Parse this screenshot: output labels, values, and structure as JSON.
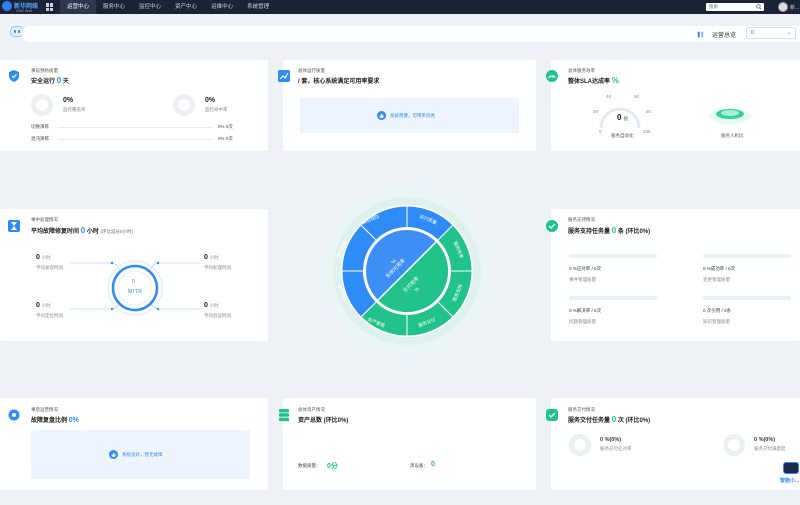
{
  "topbar": {
    "logo_text": "新华网络",
    "logo_sub": "XNC.Net",
    "nav": [
      "运营中心",
      "服务中心",
      "监控中心",
      "资产中心",
      "运维中心",
      "系统管理"
    ],
    "search_placeholder": "搜索",
    "user_name": "新..."
  },
  "subbar": {
    "label": "运营总览",
    "select_value": "0"
  },
  "card1": {
    "header": "事前预防质量",
    "title_pre": "安全运行",
    "title_value": "0",
    "title_unit": "天",
    "m1_pct": "0%",
    "m1_label": "监控覆盖率",
    "m2_pct": "0%",
    "m2_label": "监控命中率",
    "r1_label": "切换演练",
    "r1_val": "0% 0次",
    "r2_label": "混沌演练",
    "r2_val": "0% 0次"
  },
  "card2": {
    "header": "总体运行质量",
    "title": "/ 套，核心系统满足可用率要求",
    "info": "系统稳健，可用率优秀"
  },
  "card3": {
    "header": "总体服务效率",
    "title_pre": "整体SLA达成率",
    "title_value": "%",
    "gauge_value": "0",
    "gauge_unit": "分",
    "gauge_ticks": [
      "0",
      "20",
      "40",
      "60",
      "80",
      "100"
    ],
    "gauge_label": "服务自动化",
    "ratio_label": "服务人机比"
  },
  "card4": {
    "header": "事中处理情况",
    "title_pre": "平均故障修复时间",
    "title_value": "0",
    "title_unit": "小时",
    "title_note": "(环比延长0小时)",
    "center_label": "MTTR",
    "c_value": "0",
    "items": [
      {
        "val": "0",
        "unit": "小时",
        "label": "平均发现时间"
      },
      {
        "val": "0",
        "unit": "小时",
        "label": "平均处理时间"
      },
      {
        "val": "0",
        "unit": "小时",
        "label": "平均定位时间"
      },
      {
        "val": "0",
        "unit": "小时",
        "label": "平均验证时间"
      }
    ]
  },
  "wheel": {
    "center_top": "%",
    "center_mid": "系统可用率",
    "center_bottom_top": "交付效率",
    "center_bottom_val": "%",
    "segments": [
      "事前预防",
      "运行质量",
      "服务效率",
      "服务支持",
      "服务交付",
      "资产管理",
      "事后优化",
      "事中处理"
    ]
  },
  "card5": {
    "header": "服务支持情况",
    "title_pre": "服务支持任务量",
    "title_value": "0",
    "title_unit": "条",
    "title_note": "(环比0%)",
    "items": [
      {
        "val": "0 %应对率 / 0次",
        "label": "事件管理质量"
      },
      {
        "val": "0 %成功率 / 0次",
        "label": "变更管理质量"
      },
      {
        "val": "0 %解决率 / 0次",
        "label": "问题管理质量"
      },
      {
        "val": "0 次引用 / 0条",
        "label": "知识管理质量"
      }
    ]
  },
  "card6": {
    "header": "事后运营情况",
    "title_pre": "故障复盘比例",
    "title_value": "0%",
    "info": "系统良好，暂无故障"
  },
  "card7": {
    "header": "总体资产情况",
    "title": "资产总数  (环比0%)",
    "l1": "数据质量：",
    "v1": "0分",
    "l2": "黑设备：",
    "v2": "0"
  },
  "card8": {
    "header": "服务交付情况",
    "title_pre": "服务交付任务量",
    "title_value": "0",
    "title_unit": "次",
    "title_note": "(环比0%)",
    "m1_pct": "0 %(0%)",
    "m1_label": "服务交付应对率",
    "m2_pct": "0 %(0%)",
    "m2_label": "服务交付满意度"
  },
  "assistant": {
    "label": "智能小..."
  },
  "colors": {
    "blue": "#2f8cf6",
    "green": "#1ec38b",
    "topbar": "#1b2336"
  }
}
